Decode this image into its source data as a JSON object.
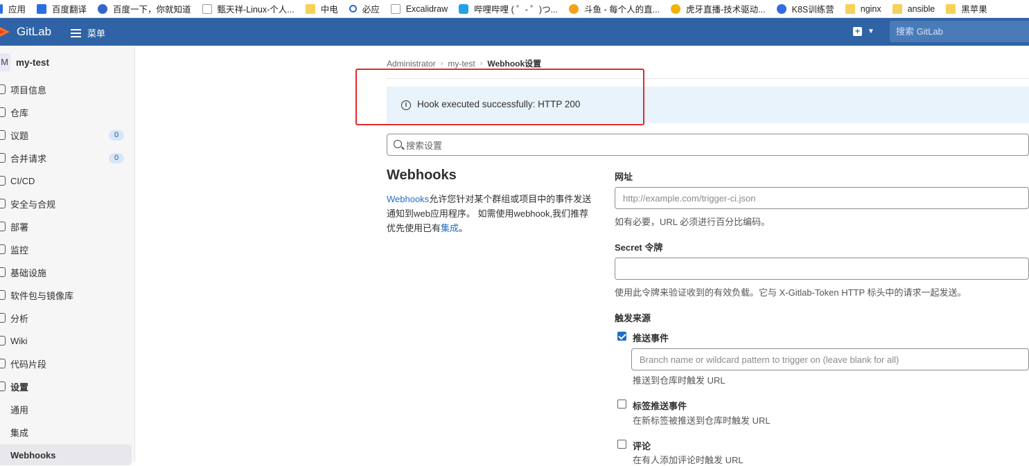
{
  "bookmarks": [
    {
      "label": "应用",
      "icon": "apps-icon"
    },
    {
      "label": "百度翻译",
      "icon": "translate-icon"
    },
    {
      "label": "百度一下，你就知道",
      "icon": "baidu-paw-icon"
    },
    {
      "label": "甄天祥-Linux-个人...",
      "icon": "page-icon"
    },
    {
      "label": "中电",
      "icon": "folder-icon"
    },
    {
      "label": "必应",
      "icon": "bing-search-icon"
    },
    {
      "label": "Excalidraw",
      "icon": "page-icon"
    },
    {
      "label": "哔哩哔哩 ( ゜- ゜)つ...",
      "icon": "bilibili-icon"
    },
    {
      "label": "斗鱼 - 每个人的直...",
      "icon": "douyu-icon"
    },
    {
      "label": "虎牙直播-技术驱动...",
      "icon": "huya-icon"
    },
    {
      "label": "K8S训练营",
      "icon": "k8s-icon"
    },
    {
      "label": "nginx",
      "icon": "folder-icon"
    },
    {
      "label": "ansible",
      "icon": "folder-icon"
    },
    {
      "label": "黑苹果",
      "icon": "folder-icon"
    }
  ],
  "topbar": {
    "brand": "GitLab",
    "menu_label": "菜单",
    "search_placeholder": "搜索 GitLab"
  },
  "sidebar": {
    "project_avatar": "M",
    "project_name": "my-test",
    "items": [
      {
        "label": "项目信息"
      },
      {
        "label": "仓库"
      },
      {
        "label": "议题",
        "badge": "0"
      },
      {
        "label": "合并请求",
        "badge": "0"
      },
      {
        "label": "CI/CD"
      },
      {
        "label": "安全与合规"
      },
      {
        "label": "部署"
      },
      {
        "label": "监控"
      },
      {
        "label": "基础设施"
      },
      {
        "label": "软件包与镜像库"
      },
      {
        "label": "分析"
      },
      {
        "label": "Wiki"
      },
      {
        "label": "代码片段"
      },
      {
        "label": "设置"
      }
    ],
    "sub_items": [
      {
        "label": "通用"
      },
      {
        "label": "集成"
      },
      {
        "label": "Webhooks"
      }
    ]
  },
  "breadcrumb": {
    "items": [
      "Administrator",
      "my-test",
      "Webhook设置"
    ]
  },
  "alert": {
    "text": "Hook executed successfully: HTTP 200"
  },
  "settings_search": {
    "placeholder": "搜索设置"
  },
  "webhooks": {
    "title": "Webhooks",
    "desc_link": "Webhooks",
    "desc_1": "允许您针对某个群组或项目中的事件发送通知到web应用程序。 如需使用webhook,我们推荐优先使用已有",
    "desc_link2": "集成",
    "desc_end": "。"
  },
  "form": {
    "url_label": "网址",
    "url_placeholder": "http://example.com/trigger-ci.json",
    "url_help": "如有必要，URL 必须进行百分比编码。",
    "secret_label": "Secret 令牌",
    "secret_value": "",
    "secret_help": "使用此令牌来验证收到的有效负载。它与 X-Gitlab-Token HTTP 标头中的请求一起发送。",
    "trigger_label": "触发来源",
    "push": {
      "label": "推送事件",
      "checked": true,
      "branch_placeholder": "Branch name or wildcard pattern to trigger on (leave blank for all)",
      "help": "推送到仓库时触发 URL"
    },
    "tag_push": {
      "label": "标签推送事件",
      "checked": false,
      "help": "在新标签被推送到仓库时触发 URL"
    },
    "comments": {
      "label": "评论",
      "checked": false,
      "help": "在有人添加评论时触发 URL"
    }
  }
}
